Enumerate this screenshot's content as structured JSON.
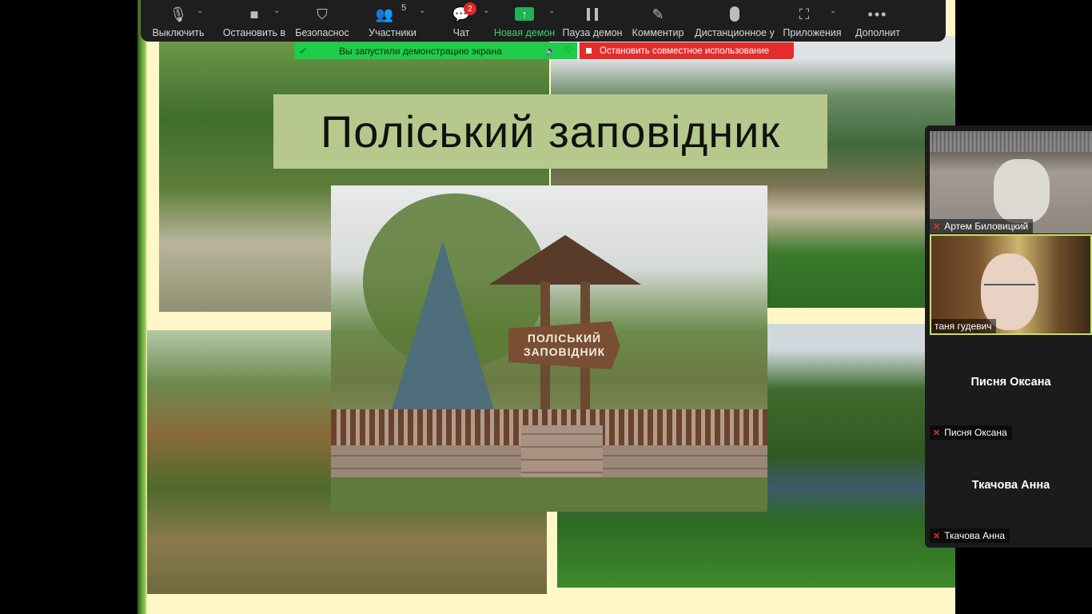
{
  "toolbar": {
    "items": [
      {
        "label": "Выключить",
        "icon": "microphone-icon"
      },
      {
        "label": "Остановить в",
        "icon": "video-camera-icon"
      },
      {
        "label": "Безопаснос",
        "icon": "shield-icon"
      },
      {
        "label": "Участники",
        "icon": "participants-icon",
        "count": "5"
      },
      {
        "label": "Чат",
        "icon": "chat-icon",
        "badge": "2"
      },
      {
        "label": "Новая демон",
        "icon": "share-screen-icon"
      },
      {
        "label": "Пауза демон",
        "icon": "pause-icon"
      },
      {
        "label": "Комментир",
        "icon": "pencil-icon"
      },
      {
        "label": "Дистанционное у",
        "icon": "mouse-icon"
      },
      {
        "label": "Приложения",
        "icon": "apps-icon"
      },
      {
        "label": "Дополнит",
        "icon": "more-icon"
      }
    ]
  },
  "share_banner": {
    "text": "Вы запустили демонстрацию экрана",
    "stop_text": "Остановить совместное использование"
  },
  "slide": {
    "title": "Поліський заповідник",
    "sign_text": "ПОЛІСЬКИЙ\nЗАПОВІДНИК"
  },
  "participants": [
    {
      "name": "Артем Биловицкий",
      "muted": true
    },
    {
      "name": "таня гудевич",
      "muted": false
    },
    {
      "name": "Писня Оксана",
      "display": "Писня Оксана",
      "muted": true
    },
    {
      "name": "Ткачова Анна",
      "display": "Ткачова Анна",
      "muted": true
    }
  ],
  "colors": {
    "share_green": "#1fcc47",
    "stop_red": "#e32d2d",
    "title_box": "#b6c88b",
    "active_speaker_border": "#c9e062"
  }
}
